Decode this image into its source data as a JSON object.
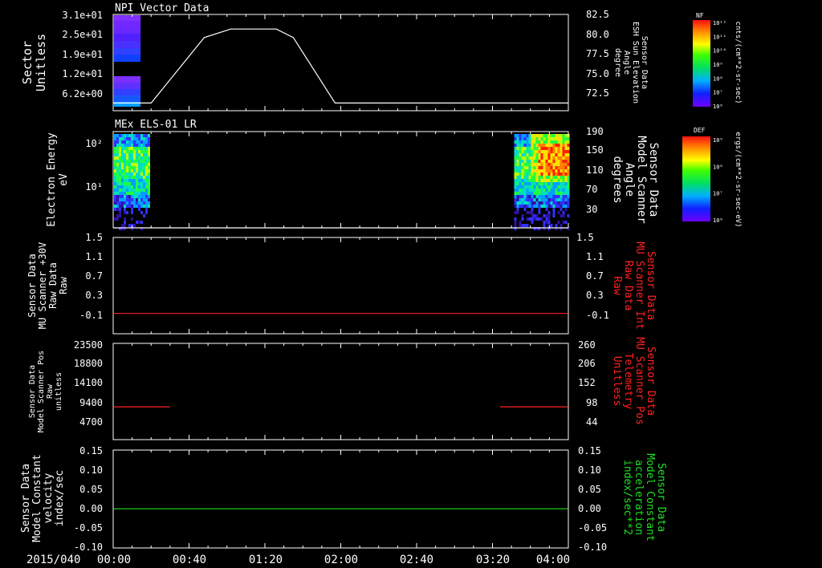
{
  "date_label": "2015/040",
  "time_ticks": [
    "00:00",
    "00:40",
    "01:20",
    "02:00",
    "02:40",
    "03:20",
    "04:00"
  ],
  "time_range_min": [
    0,
    240
  ],
  "colors": {
    "background": "#000000",
    "axis": "#ffffff",
    "red": "#ff2020",
    "green": "#20e020"
  },
  "chart_data": [
    {
      "id": "panel1",
      "type": "heatmap",
      "title": "NPI Vector Data",
      "ylabel_left": [
        "Sector",
        "Unitless"
      ],
      "yticks_left": [
        "3.1e+01",
        "2.5e+01",
        "1.9e+01",
        "1.2e+01",
        "6.2e+00"
      ],
      "ylabel_right": [
        "Sensor Data",
        "ESH Sun Elevation",
        "Angle",
        "degree"
      ],
      "yticks_right": [
        "82.5",
        "80.0",
        "77.5",
        "75.0",
        "72.5"
      ],
      "right_ylim": [
        70,
        82.5
      ],
      "line_series": {
        "color": "white",
        "x_min": [
          0,
          20,
          48,
          62,
          86,
          95,
          117,
          124,
          240
        ],
        "y": [
          71,
          71,
          79.5,
          80.6,
          80.6,
          79.5,
          71,
          71,
          71
        ]
      },
      "heatmap_x_min": [
        0,
        14
      ],
      "colorbar": {
        "label": "NF",
        "units": "cnts/(cm**2-sr-sec)",
        "ticks": [
          "10¹²",
          "10¹¹",
          "10¹⁰",
          "10⁹",
          "10⁸",
          "10⁷",
          "10⁶"
        ]
      }
    },
    {
      "id": "panel2",
      "type": "heatmap",
      "title": "MEx ELS-01 LR",
      "ylabel_left": [
        "Electron Energy",
        "eV"
      ],
      "yticks_left": [
        "10²",
        "10¹"
      ],
      "ylabel_right": [
        "Sensor Data",
        "Model Scanner",
        "Angle",
        "degrees"
      ],
      "yticks_right": [
        "190",
        "150",
        "110",
        "70",
        "30"
      ],
      "right_ylim": [
        10,
        190
      ],
      "line_series": {
        "color": "white",
        "x_min": [
          0,
          240
        ],
        "y": [
          10,
          10
        ]
      },
      "heatmap_x_min": [
        [
          0,
          19
        ],
        [
          211,
          240
        ]
      ],
      "colorbar": {
        "label": "DEF",
        "units": "ergs/(cm**2-sr-sec-eV)",
        "ticks": [
          "10⁹",
          "10⁸",
          "10⁷",
          "10⁶"
        ]
      }
    },
    {
      "id": "panel3",
      "type": "line",
      "ylabel_left": [
        "Sensor Data",
        "MU Scanner +30V",
        "Raw Data",
        "Raw"
      ],
      "yticks_left": [
        "1.5",
        "1.1",
        "0.7",
        "0.3",
        "-0.1"
      ],
      "ylabel_right": [
        "Sensor Data",
        "MU Scanner Int",
        "Raw Data",
        "Raw"
      ],
      "yticks_right": [
        "1.5",
        "1.1",
        "0.7",
        "0.3",
        "-0.1"
      ],
      "ylim": [
        -0.4,
        1.5
      ],
      "series": [
        {
          "color": "red",
          "x_min": [
            0,
            240
          ],
          "y": [
            0,
            0
          ]
        }
      ]
    },
    {
      "id": "panel4",
      "type": "line",
      "ylabel_left": [
        "Sensor Data",
        "Model Scanner Pos",
        "Raw",
        "unitless"
      ],
      "yticks_left": [
        "23500",
        "18800",
        "14100",
        "9400",
        "4700"
      ],
      "ylabel_right": [
        "Sensor Data",
        "MU Scanner Pos",
        "Telemetry",
        "Unitless"
      ],
      "yticks_right": [
        "260",
        "206",
        "152",
        "98",
        "44"
      ],
      "ylim": [
        0,
        23500
      ],
      "series": [
        {
          "color": "red",
          "x_min": [
            0,
            30
          ],
          "y": [
            8000,
            8000
          ]
        },
        {
          "color": "red",
          "x_min": [
            204,
            240
          ],
          "y": [
            8000,
            8000
          ]
        }
      ]
    },
    {
      "id": "panel5",
      "type": "line",
      "ylabel_left": [
        "Sensor Data",
        "Model Constant",
        "velocity",
        "index/sec"
      ],
      "yticks_left": [
        "0.15",
        "0.10",
        "0.05",
        "0.00",
        "-0.05",
        "-0.10"
      ],
      "ylabel_right": [
        "Sensor Data",
        "Model Constant",
        "acceleration",
        "index/sec**2"
      ],
      "yticks_right": [
        "0.15",
        "0.10",
        "0.05",
        "0.00",
        "-0.05",
        "-0.10"
      ],
      "ylim": [
        -0.1,
        0.15
      ],
      "series": [
        {
          "color": "green",
          "x_min": [
            0,
            240
          ],
          "y": [
            0,
            0
          ]
        }
      ]
    }
  ]
}
